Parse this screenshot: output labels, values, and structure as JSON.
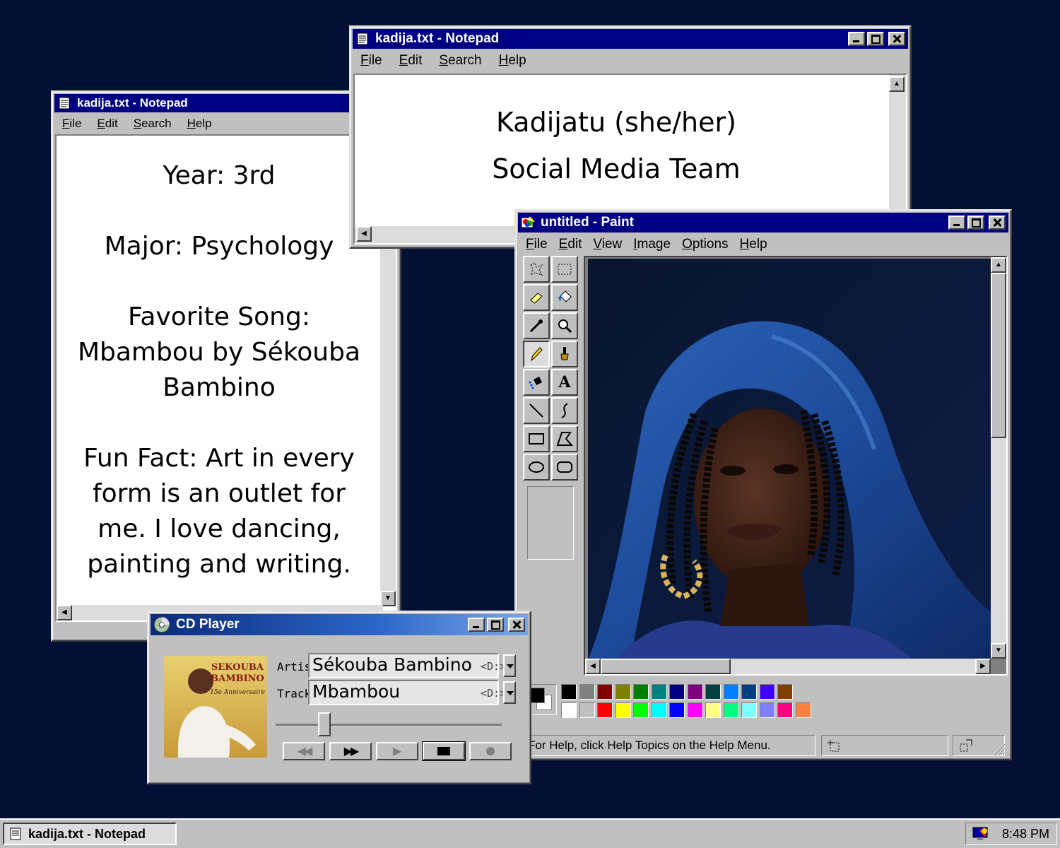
{
  "notepad_left": {
    "title": "kadija.txt - Notepad",
    "menu": [
      "File",
      "Edit",
      "Search",
      "Help"
    ],
    "lines": [
      "Year: 3rd",
      "",
      "Major: Psychology",
      "",
      "Favorite Song:",
      "Mbambou by Sékouba",
      "Bambino",
      "",
      "Fun Fact: Art in every",
      "form is an outlet for",
      "me. I love dancing,",
      "painting and writing."
    ]
  },
  "notepad_top": {
    "title": "kadija.txt - Notepad",
    "menu": [
      "File",
      "Edit",
      "Search",
      "Help"
    ],
    "lines": [
      "Kadijatu (she/her)",
      "Social Media Team"
    ]
  },
  "paint": {
    "title": "untitled - Paint",
    "menu": [
      "File",
      "Edit",
      "View",
      "Image",
      "Options",
      "Help"
    ],
    "status_text": "For Help, click Help Topics on the Help Menu.",
    "palette_top": [
      "#000000",
      "#808080",
      "#800000",
      "#808000",
      "#008000",
      "#008080",
      "#000080",
      "#800080",
      "#004040",
      "#0080ff",
      "#004080",
      "#4000ff",
      "#804000"
    ],
    "palette_bottom": [
      "#ffffff",
      "#c0c0c0",
      "#ff0000",
      "#ffff00",
      "#00ff00",
      "#00ffff",
      "#0000ff",
      "#ff00ff",
      "#ffff80",
      "#00ff80",
      "#80ffff",
      "#8080ff",
      "#ff0080",
      "#ff8040"
    ],
    "tools": [
      "free-select",
      "rect-select",
      "eraser",
      "fill",
      "eyedropper",
      "magnifier",
      "pencil",
      "brush",
      "airbrush",
      "text",
      "line",
      "curve",
      "rectangle",
      "polygon",
      "ellipse",
      "rounded-rectangle"
    ]
  },
  "cd_player": {
    "title": "CD Player",
    "artist_label": "Artist:",
    "artist": "Sékouba Bambino",
    "track_label": "Track:",
    "track": "Mbambou",
    "drive": "<D:>",
    "album_line1": "SEKOUBA",
    "album_line2": "BAMBINO",
    "album_line3": "15e Anniversaire",
    "position_fraction": 0.2
  },
  "taskbar": {
    "task_label": "kadija.txt - Notepad",
    "clock": "8:48 PM"
  }
}
